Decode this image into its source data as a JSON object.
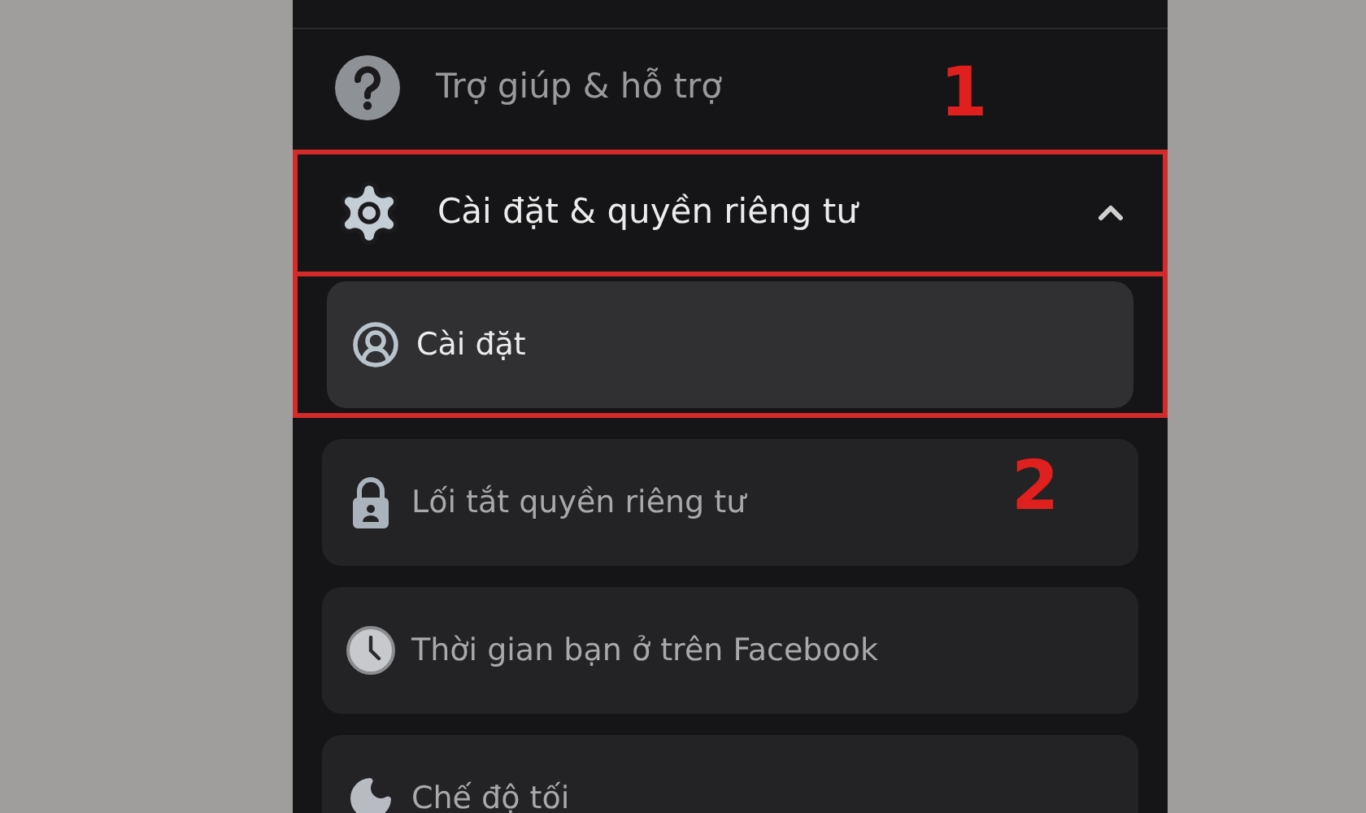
{
  "menu": [
    {
      "kind": "row",
      "label": "Trợ giúp & hỗ trợ"
    },
    {
      "kind": "section",
      "label": "Cài đặt & quyền riêng tư",
      "expanded": true,
      "children": [
        {
          "label": "Cài đặt",
          "selected": true
        },
        {
          "label": "Lối tắt quyền riêng tư",
          "selected": false
        },
        {
          "label": "Thời gian bạn ở trên Facebook",
          "selected": false
        },
        {
          "label": "Chế độ tối",
          "selected": false
        }
      ]
    }
  ],
  "markers": [
    {
      "label": "1"
    },
    {
      "label": "2"
    }
  ]
}
